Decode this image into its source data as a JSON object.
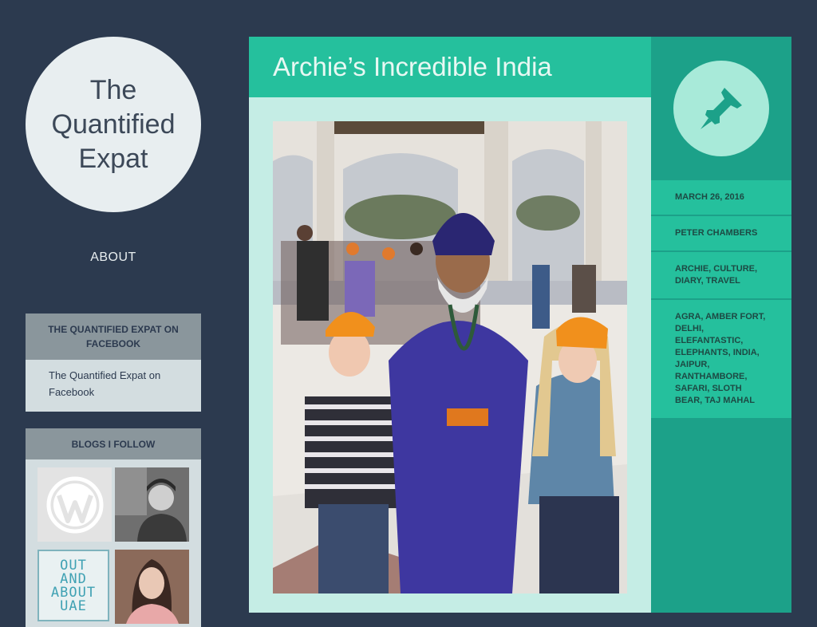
{
  "site": {
    "title": "The Quantified Expat"
  },
  "nav": {
    "about_label": "ABOUT"
  },
  "widgets": {
    "facebook": {
      "heading": "THE QUANTIFIED EXPAT ON FACEBOOK",
      "link_text": "The Quantified Expat on Facebook"
    },
    "blogs": {
      "heading": "BLOGS I FOLLOW",
      "tiles": [
        {
          "name": "wordpress-logo"
        },
        {
          "name": "blogger-avatar-man"
        },
        {
          "name": "out-and-about-uae",
          "text": [
            "OUT",
            "AND",
            "ABOUT",
            "UAE"
          ]
        },
        {
          "name": "blogger-avatar-woman"
        }
      ]
    }
  },
  "post": {
    "title": "Archie’s Incredible India",
    "excerpt": "..."
  },
  "meta": {
    "date": "MARCH 26, 2016",
    "author": "PETER CHAMBERS",
    "categories": "ARCHIE, CULTURE, DIARY, TRAVEL",
    "tags": "AGRA, AMBER FORT, DELHI, ELEFANTASTIC, ELEPHANTS, INDIA, JAIPUR, RANTHAMBORE, SAFARI, SLOTH BEAR, TAJ MAHAL"
  },
  "icons": {
    "post_format": "pushpin-icon"
  },
  "colors": {
    "background": "#2c3a4f",
    "accent": "#25c09d",
    "accent_dark": "#1ca189",
    "content_bg": "#c5ede5"
  }
}
